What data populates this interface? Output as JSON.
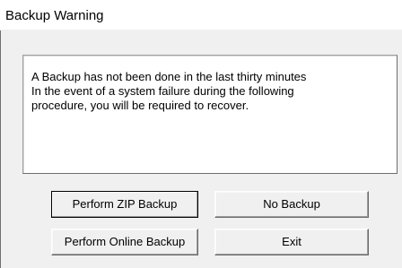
{
  "window": {
    "title": "Backup Warning"
  },
  "message": {
    "lines": [
      "A Backup has not been done in the last thirty minutes",
      "In the event of a system failure during the following",
      "procedure, you will be required to recover."
    ]
  },
  "buttons": {
    "perform_zip_backup": "Perform ZIP Backup",
    "no_backup": "No Backup",
    "perform_online_backup": "Perform Online Backup",
    "exit": "Exit"
  },
  "colors": {
    "dialog_background": "#f0f0f0",
    "title_bar_background": "#ffffff",
    "message_background": "#ffffff"
  }
}
